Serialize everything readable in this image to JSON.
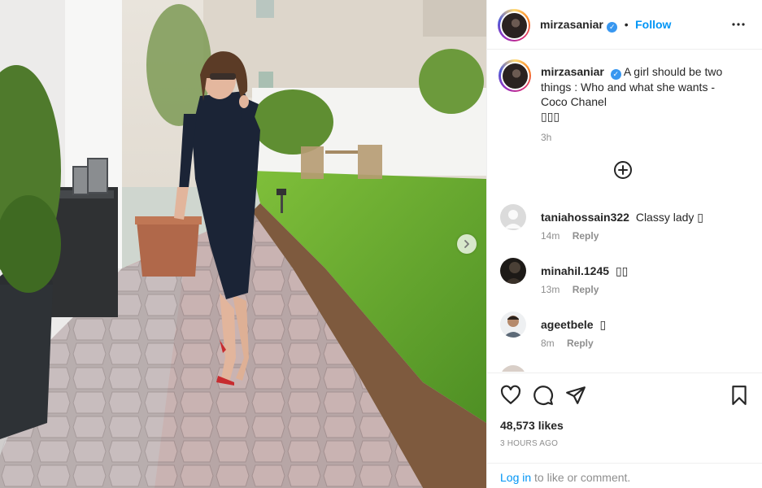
{
  "post": {
    "username": "mirzasaniar",
    "follow_label": "Follow",
    "separator": "•",
    "caption": "A girl should be two things : Who and what she wants - Coco Chanel",
    "caption_emojis": "▯▯▯",
    "caption_time": "3h"
  },
  "comments": [
    {
      "username": "taniahossain322",
      "text": "Classy lady ▯",
      "time": "14m",
      "reply_label": "Reply"
    },
    {
      "username": "minahil.1245",
      "text": "▯▯",
      "time": "13m",
      "reply_label": "Reply"
    },
    {
      "username": "ageetbele",
      "text": "▯",
      "time": "8m",
      "reply_label": "Reply"
    }
  ],
  "footer": {
    "likes": "48,573 likes",
    "posted": "3 HOURS AGO",
    "login_link": "Log in",
    "login_rest": " to like or comment."
  },
  "icons": {
    "verified": "verified-badge-icon",
    "more": "more-options-icon",
    "add_comment": "plus-circle-icon",
    "like": "heart-icon",
    "comment": "comment-bubble-icon",
    "share": "paper-plane-icon",
    "save": "bookmark-icon",
    "next": "chevron-right-icon"
  },
  "colors": {
    "accent": "#0095f6",
    "verified": "#3897f0",
    "muted": "#8e8e8e"
  }
}
